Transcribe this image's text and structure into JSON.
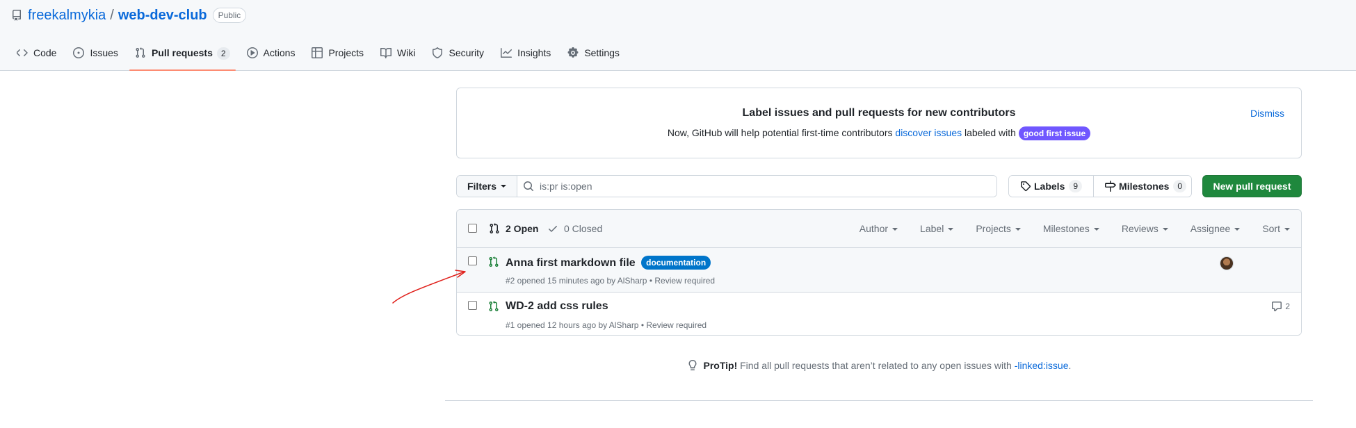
{
  "repo": {
    "owner": "freekalmykia",
    "separator": "/",
    "name": "web-dev-club",
    "visibility": "Public"
  },
  "tabs": [
    {
      "label": "Code",
      "icon": "code-icon"
    },
    {
      "label": "Issues",
      "icon": "issue-opened-icon"
    },
    {
      "label": "Pull requests",
      "icon": "git-pull-request-icon",
      "count": "2",
      "active": true
    },
    {
      "label": "Actions",
      "icon": "play-icon"
    },
    {
      "label": "Projects",
      "icon": "table-icon"
    },
    {
      "label": "Wiki",
      "icon": "book-icon"
    },
    {
      "label": "Security",
      "icon": "shield-icon"
    },
    {
      "label": "Insights",
      "icon": "graph-icon"
    },
    {
      "label": "Settings",
      "icon": "gear-icon"
    }
  ],
  "banner": {
    "title": "Label issues and pull requests for new contributors",
    "text_before": "Now, GitHub will help potential first-time contributors",
    "link": "discover issues",
    "text_after": "labeled with",
    "label": "good first issue",
    "dismiss": "Dismiss"
  },
  "toolbar": {
    "filters": "Filters",
    "search_value": "is:pr is:open",
    "labels": "Labels",
    "labels_count": "9",
    "milestones": "Milestones",
    "milestones_count": "0",
    "new_pr": "New pull request"
  },
  "list_header": {
    "open": "2 Open",
    "closed": "0 Closed",
    "sorts": [
      "Author",
      "Label",
      "Projects",
      "Milestones",
      "Reviews",
      "Assignee",
      "Sort"
    ]
  },
  "pull_requests": [
    {
      "title": "Anna first markdown file",
      "label": "documentation",
      "label_color": "#0075ca",
      "meta": "#2 opened 15 minutes ago by AlSharp • Review required",
      "has_assignee": true
    },
    {
      "title": "WD-2 add css rules",
      "meta": "#1 opened 12 hours ago by AlSharp • Review required",
      "comments": "2"
    }
  ],
  "protip": {
    "lead": "ProTip!",
    "text": "Find all pull requests that aren’t related to any open issues with",
    "link": "-linked:issue",
    "end": "."
  },
  "colors": {
    "accent": "#0969da",
    "primary_button": "#1f883d",
    "active_tab_underline": "#fd8c73",
    "open_pr": "#1a7f37",
    "good_first_issue": "#7057ff",
    "annotation_arrow": "#e0201b"
  }
}
